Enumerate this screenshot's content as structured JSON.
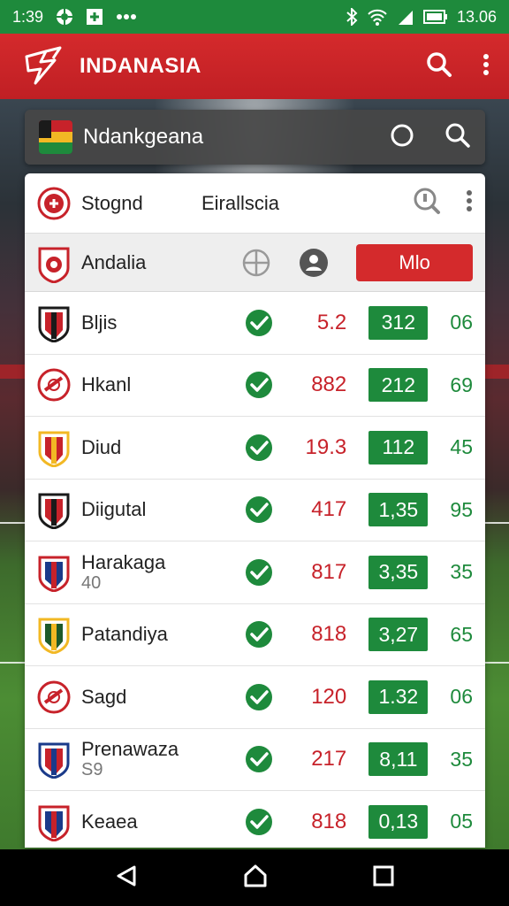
{
  "status": {
    "time": "1:39",
    "battery_time": "13.06"
  },
  "app": {
    "title": "INDANASIA"
  },
  "search": {
    "value": "Ndankgeana"
  },
  "card": {
    "header": {
      "title": "Stognd",
      "subtitle": "Eirallscia"
    },
    "subheader": {
      "name": "Andalia",
      "button": "Mlo"
    },
    "rows": [
      {
        "name": "Bljis",
        "sub": "",
        "v1": "5.2",
        "v2": "312",
        "v3": "06"
      },
      {
        "name": "Hkanl",
        "sub": "",
        "v1": "882",
        "v2": "212",
        "v3": "69"
      },
      {
        "name": "Diud",
        "sub": "",
        "v1": "19.3",
        "v2": "112",
        "v3": "45"
      },
      {
        "name": "Diigutal",
        "sub": "",
        "v1": "417",
        "v2": "1,35",
        "v3": "95"
      },
      {
        "name": "Harakaga",
        "sub": "40",
        "v1": "817",
        "v2": "3,35",
        "v3": "35"
      },
      {
        "name": "Patandiya",
        "sub": "",
        "v1": "818",
        "v2": "3,27",
        "v3": "65"
      },
      {
        "name": "Sagd",
        "sub": "",
        "v1": "120",
        "v2": "1.32",
        "v3": "06"
      },
      {
        "name": "Prenawaza",
        "sub": "S9",
        "v1": "217",
        "v2": "8,11",
        "v3": "35"
      },
      {
        "name": "Keaea",
        "sub": "",
        "v1": "818",
        "v2": "0,13",
        "v3": "05"
      }
    ]
  },
  "colors": {
    "brand_red": "#d42a2c",
    "status_green": "#1e8a3c",
    "value_red": "#c7222a"
  }
}
